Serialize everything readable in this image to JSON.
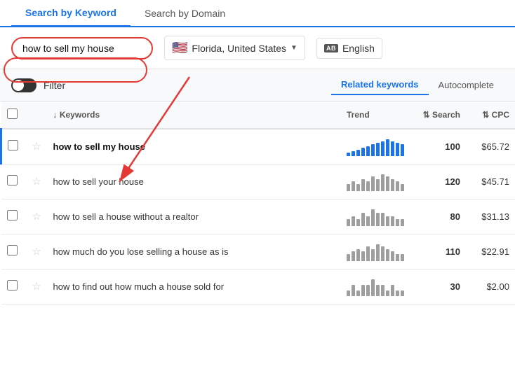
{
  "tabs": [
    {
      "id": "keyword",
      "label": "Search by Keyword",
      "active": true
    },
    {
      "id": "domain",
      "label": "Search by Domain",
      "active": false
    }
  ],
  "search": {
    "keyword_value": "how to sell my house",
    "location_flag": "🇺🇸",
    "location_label": "Florida, United States",
    "lang_label": "English",
    "lang_icon": "AB"
  },
  "filter": {
    "label": "Filter",
    "tabs": [
      {
        "id": "related",
        "label": "Related keywords",
        "active": true
      },
      {
        "id": "autocomplete",
        "label": "Autocomplete",
        "active": false
      }
    ]
  },
  "table": {
    "columns": [
      {
        "id": "checkbox",
        "label": ""
      },
      {
        "id": "star",
        "label": ""
      },
      {
        "id": "keywords",
        "label": "Keywords",
        "sortable": true
      },
      {
        "id": "trend",
        "label": "Trend"
      },
      {
        "id": "search",
        "label": "Search",
        "sortable": true
      },
      {
        "id": "cpc",
        "label": "CPC",
        "sortable": true
      }
    ],
    "rows": [
      {
        "keyword": "how to sell my house",
        "trend_bars": [
          2,
          3,
          4,
          5,
          6,
          7,
          8,
          9,
          10,
          9,
          8,
          7
        ],
        "trend_color": "#1a73e8",
        "search": "100",
        "cpc": "$65.72",
        "highlighted": true,
        "bold": true
      },
      {
        "keyword": "how to sell your house",
        "trend_bars": [
          3,
          4,
          3,
          5,
          4,
          6,
          5,
          7,
          6,
          5,
          4,
          3
        ],
        "trend_color": "#9e9e9e",
        "search": "120",
        "cpc": "$45.71",
        "highlighted": false,
        "bold": false
      },
      {
        "keyword": "how to sell a house without a realtor",
        "trend_bars": [
          2,
          3,
          2,
          4,
          3,
          5,
          4,
          4,
          3,
          3,
          2,
          2
        ],
        "trend_color": "#9e9e9e",
        "search": "80",
        "cpc": "$31.13",
        "highlighted": false,
        "bold": false
      },
      {
        "keyword": "how much do you lose selling a house as is",
        "trend_bars": [
          3,
          4,
          5,
          4,
          6,
          5,
          7,
          6,
          5,
          4,
          3,
          3
        ],
        "trend_color": "#9e9e9e",
        "search": "110",
        "cpc": "$22.91",
        "highlighted": false,
        "bold": false
      },
      {
        "keyword": "how to find out how much a house sold for",
        "trend_bars": [
          1,
          2,
          1,
          2,
          2,
          3,
          2,
          2,
          1,
          2,
          1,
          1
        ],
        "trend_color": "#9e9e9e",
        "search": "30",
        "cpc": "$2.00",
        "highlighted": false,
        "bold": false
      }
    ]
  },
  "annotation": {
    "arrow_visible": true
  }
}
